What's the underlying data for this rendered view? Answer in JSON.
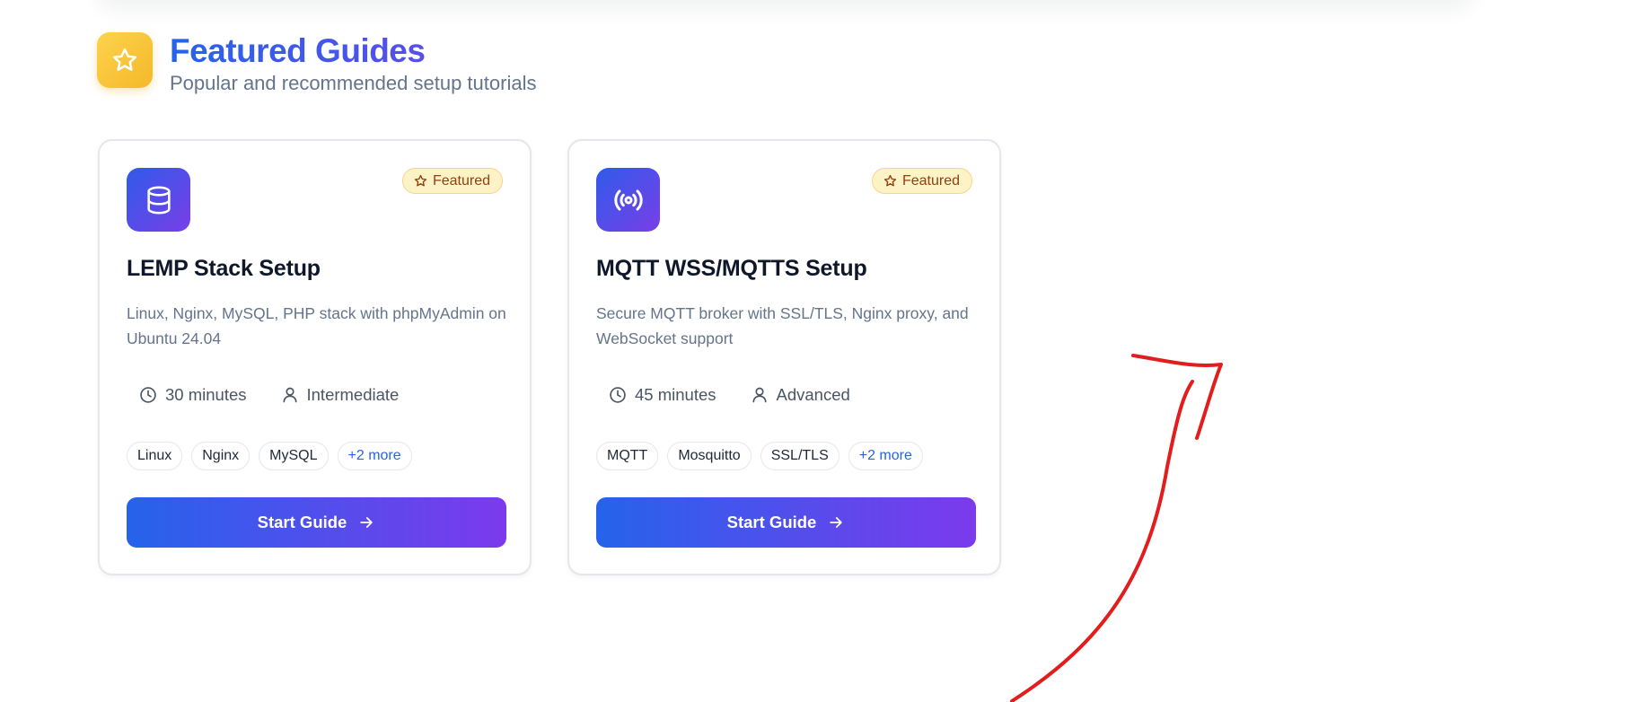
{
  "section": {
    "title": "Featured Guides",
    "subtitle": "Popular and recommended setup tutorials",
    "icon": "star-icon"
  },
  "cards": [
    {
      "icon": "database-icon",
      "badge": "Featured",
      "title": "LEMP Stack Setup",
      "description": "Linux, Nginx, MySQL, PHP stack with phpMyAdmin on Ubuntu 24.04",
      "duration": "30 minutes",
      "level": "Intermediate",
      "tags": [
        "Linux",
        "Nginx",
        "MySQL"
      ],
      "more_tags": "+2 more",
      "button": "Start Guide"
    },
    {
      "icon": "broadcast-icon",
      "badge": "Featured",
      "title": "MQTT WSS/MQTTS Setup",
      "description": "Secure MQTT broker with SSL/TLS, Nginx proxy, and WebSocket support",
      "duration": "45 minutes",
      "level": "Advanced",
      "tags": [
        "MQTT",
        "Mosquitto",
        "SSL/TLS"
      ],
      "more_tags": "+2 more",
      "button": "Start Guide"
    }
  ],
  "colors": {
    "accent_start": "#2563eb",
    "accent_end": "#7c3aed",
    "badge_bg": "#fef3c7",
    "badge_text": "#92400e",
    "annotation": "#e11d1d"
  }
}
